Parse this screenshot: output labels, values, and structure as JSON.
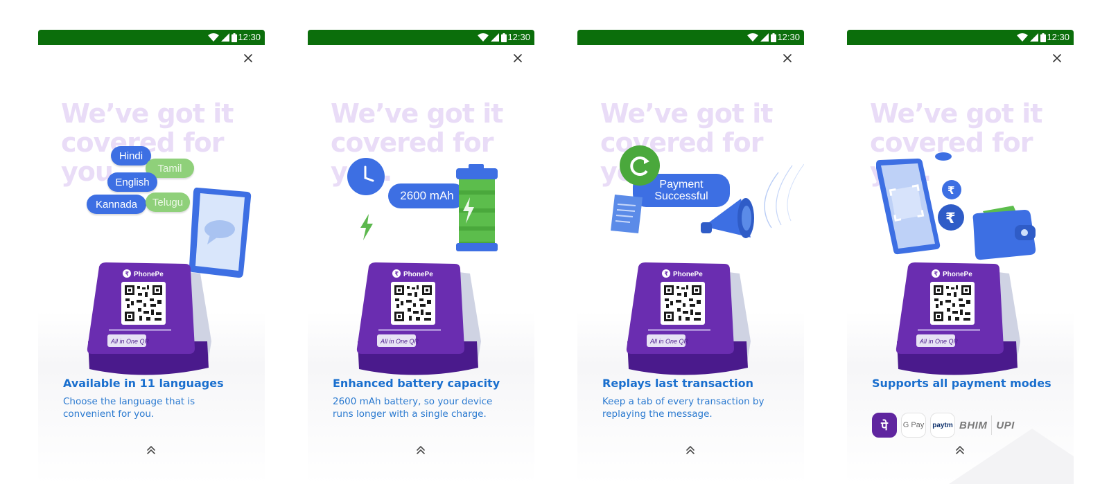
{
  "status_bar": {
    "time": "12:30"
  },
  "screens": [
    {
      "headline": "We’ve got it covered for you.",
      "title": "Available in 11 languages",
      "description": "Choose the language that is convenient for you.",
      "languages": [
        "Hindi",
        "Tamil",
        "English",
        "Kannada",
        "Telugu"
      ]
    },
    {
      "headline": "We’ve got it covered for you.",
      "title": "Enhanced battery capacity",
      "description": "2600 mAh battery, so your device runs longer with a single charge.",
      "battery_label": "2600 mAh"
    },
    {
      "headline": "We’ve got it covered for you.",
      "title": "Replays last transaction",
      "description": "Keep a tab of every transaction by replaying the message.",
      "bubble_text": "Payment Successful"
    },
    {
      "headline": "We’ve got it covered for you.",
      "title": "Supports all payment modes",
      "payment_modes": [
        "पे",
        "G Pay",
        "paytm",
        "BHIM",
        "UPI"
      ]
    }
  ],
  "device": {
    "brand": "PhonePe",
    "qr_label": "All in One QR"
  },
  "colors": {
    "status_bar": "#0b6e0b",
    "accent": "#1a6fce",
    "device_purple": "#5f259f",
    "headline": "#e9dcf7"
  },
  "icons": [
    "wifi-icon",
    "signal-icon",
    "battery-icon",
    "close-icon",
    "chevron-double-up-icon"
  ]
}
